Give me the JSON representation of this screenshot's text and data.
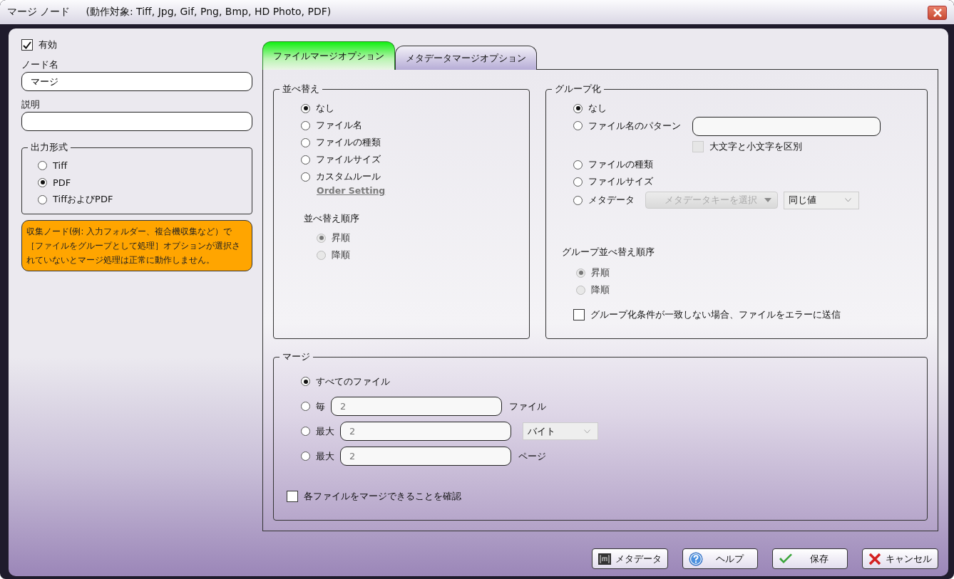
{
  "window": {
    "title": "マージ ノード",
    "subtitle": "(動作対象: Tiff, Jpg, Gif, Png, Bmp, HD Photo, PDF)"
  },
  "enabled": {
    "label": "有効",
    "checked": true
  },
  "node_name": {
    "label": "ノード名",
    "value": "マージ"
  },
  "description": {
    "label": "説明"
  },
  "output_format": {
    "legend": "出力形式",
    "options": [
      {
        "label": "Tiff",
        "selected": false
      },
      {
        "label": "PDF",
        "selected": true
      },
      {
        "label": "TiffおよびPDF",
        "selected": false
      }
    ]
  },
  "warning": "収集ノード(例: 入力フォルダー、複合機収集など）で［ファイルをグループとして処理］オプションが選択されていないとマージ処理は正常に動作しません。",
  "tabs": [
    {
      "label": "ファイルマージオプション",
      "selected": true
    },
    {
      "label": "メタデータマージオプション",
      "selected": false
    }
  ],
  "sort": {
    "legend": "並べ替え",
    "options": [
      {
        "label": "なし",
        "selected": true
      },
      {
        "label": "ファイル名",
        "selected": false
      },
      {
        "label": "ファイルの種類",
        "selected": false
      },
      {
        "label": "ファイルサイズ",
        "selected": false
      },
      {
        "label": "カスタムルール",
        "selected": false
      }
    ],
    "link": "Order Setting",
    "order_label": "並べ替え順序",
    "order_options": [
      {
        "label": "昇順",
        "selected": true,
        "disabled": true
      },
      {
        "label": "降順",
        "selected": false,
        "disabled": true
      }
    ]
  },
  "grouping": {
    "legend": "グループ化",
    "options": [
      {
        "kind": "plain",
        "label": "なし",
        "selected": true
      },
      {
        "kind": "pattern",
        "label": "ファイル名のパターン",
        "selected": false
      },
      {
        "kind": "plain",
        "label": "ファイルの種類",
        "selected": false
      },
      {
        "kind": "plain",
        "label": "ファイルサイズ",
        "selected": false
      },
      {
        "kind": "metadata",
        "label": "メタデータ",
        "selected": false
      }
    ],
    "case_sensitive": {
      "label": "大文字と小文字を区別",
      "checked": false,
      "disabled": true
    },
    "metadata_key": {
      "value": "メタデータキーを選択",
      "disabled": true
    },
    "match": {
      "value": "同じ値"
    },
    "order_label": "グループ並べ替え順序",
    "order_options": [
      {
        "label": "昇順",
        "selected": true,
        "disabled": true
      },
      {
        "label": "降順",
        "selected": false,
        "disabled": true
      }
    ],
    "error_option": {
      "label": "グループ化条件が一致しない場合、ファイルをエラーに送信",
      "checked": false
    }
  },
  "merge": {
    "legend": "マージ",
    "options": [
      {
        "kind": "all",
        "label": "すべてのファイル",
        "selected": true
      },
      {
        "kind": "count",
        "label": "毎",
        "value": "2",
        "unit": "ファイル",
        "selected": false,
        "disabled": true
      },
      {
        "kind": "size",
        "label": "最大",
        "value": "2",
        "unit_select": "バイト",
        "selected": false,
        "disabled": true
      },
      {
        "kind": "pages",
        "label": "最大",
        "value": "2",
        "unit": "ページ",
        "selected": false,
        "disabled": true
      }
    ],
    "verify": {
      "label": "各ファイルをマージできることを確認",
      "checked": false
    }
  },
  "buttons": [
    {
      "kind": "metadata",
      "label": "メタデータ"
    },
    {
      "kind": "help",
      "label": "ヘルプ"
    },
    {
      "kind": "save",
      "label": "保存"
    },
    {
      "kind": "cancel",
      "label": "キャンセル"
    }
  ]
}
